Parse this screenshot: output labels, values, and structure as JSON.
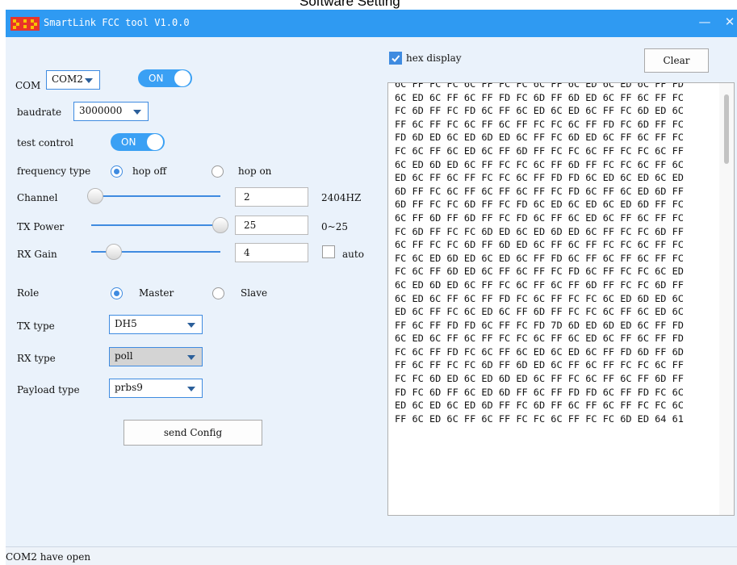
{
  "caption": "Software Setting",
  "window": {
    "title": "SmartLink FCC tool V1.0.0",
    "minimize_glyph": "—",
    "close_glyph": "✕"
  },
  "colors": {
    "titlebar": "#2f9af2",
    "accent": "#3f8be0",
    "toggle_on": "#3aa0f4",
    "panel_bg": "#eaf2fb"
  },
  "settings": {
    "com_label": "COM",
    "com_value": "COM2",
    "com_toggle": "ON",
    "baudrate_label": "baudrate",
    "baudrate_value": "3000000",
    "test_control_label": "test control",
    "test_control_toggle": "ON",
    "frequency_type_label": "frequency type",
    "hop_off_label": "hop off",
    "hop_on_label": "hop on",
    "frequency_selected": "hop off",
    "channel_label": "Channel",
    "channel_value": "2",
    "channel_freq": "2404HZ",
    "tx_power_label": "TX Power",
    "tx_power_value": "25",
    "tx_power_range": "0~25",
    "tx_power_fraction": 1.0,
    "rx_gain_label": "RX Gain",
    "rx_gain_value": "4",
    "auto_label": "auto",
    "auto_checked": false,
    "role_label": "Role",
    "master_label": "Master",
    "slave_label": "Slave",
    "role_selected": "Master",
    "tx_type_label": "TX type",
    "tx_type_value": "DH5",
    "rx_type_label": "RX type",
    "rx_type_value": "poll",
    "payload_type_label": "Payload type",
    "payload_type_value": "prbs9",
    "send_config_label": "send Config"
  },
  "output": {
    "hex_display_label": "hex display",
    "hex_display_checked": true,
    "clear_label": "Clear",
    "lines": [
      "6C FF FC FC 6C FF FC FC 6C FF 6C ED 6C ED 6C FF FD",
      "6C ED 6C FF 6C FF FD FC 6D FF 6D ED 6C FF 6C FF FC",
      "FC 6D FF FC FD 6C FF 6C ED 6C ED 6C FF FC 6D ED 6C",
      "FF 6C FF FC 6C FF 6C FF FC FC 6C FF FD FC 6D FF FC",
      "FD 6D ED 6C ED 6D ED 6C FF FC 6D ED 6C FF 6C FF FC",
      "FC 6C FF 6C ED 6C FF 6D FF FC FC 6C FF FC FC 6C FF",
      "6C ED 6D ED 6C FF FC FC 6C FF 6D FF FC FC 6C FF 6C",
      "ED 6C FF 6C FF FC FC 6C FF FD FD 6C ED 6C ED 6C ED",
      "6D FF FC 6C FF 6C FF 6C FF FC FD 6C FF 6C ED 6D FF",
      "6D FF FC FC 6D FF FC FD 6C ED 6C ED 6C ED 6D FF FC",
      "6C FF 6D FF 6D FF FC FD 6C FF 6C ED 6C FF 6C FF FC",
      "FC 6D FF FC FC 6D ED 6C ED 6D ED 6C FF FC FC 6D FF",
      "6C FF FC FC 6D FF 6D ED 6C FF 6C FF FC FC 6C FF FC",
      "FC 6C ED 6D ED 6C ED 6C FF FD 6C FF 6C FF 6C FF FC",
      "FC 6C FF 6D ED 6C FF 6C FF FC FD 6C FF FC FC 6C ED",
      "6C ED 6D ED 6C FF FC 6C FF 6C FF 6D FF FC FC 6D FF",
      "6C ED 6C FF 6C FF FD FC 6C FF FC FC 6C ED 6D ED 6C",
      "ED 6C FF FC 6C ED 6C FF 6D FF FC FC 6C FF 6C ED 6C",
      "FF 6C FF FD FD 6C FF FC FD 7D 6D ED 6D ED 6C FF FD",
      "6C ED 6C FF 6C FF FC FC 6C FF 6C ED 6C FF 6C FF FD",
      "FC 6C FF FD FC 6C FF 6C ED 6C ED 6C FF FD 6D FF 6D",
      "FF 6C FF FC FC 6D FF 6D ED 6C FF 6C FF FC FC 6C FF",
      "FC FC 6D ED 6C ED 6D ED 6C FF FC 6C FF 6C FF 6D FF",
      "FD FC 6D FF 6C ED 6D FF 6C FF FD FD 6C FF FD FC 6C",
      "ED 6C ED 6C ED 6D FF FC 6D FF 6C FF 6C FF FC FC 6C",
      "FF 6C ED 6C FF 6C FF FC FC 6C FF FC FC 6D ED 64 61"
    ]
  },
  "status": {
    "text": "COM2 have open"
  }
}
